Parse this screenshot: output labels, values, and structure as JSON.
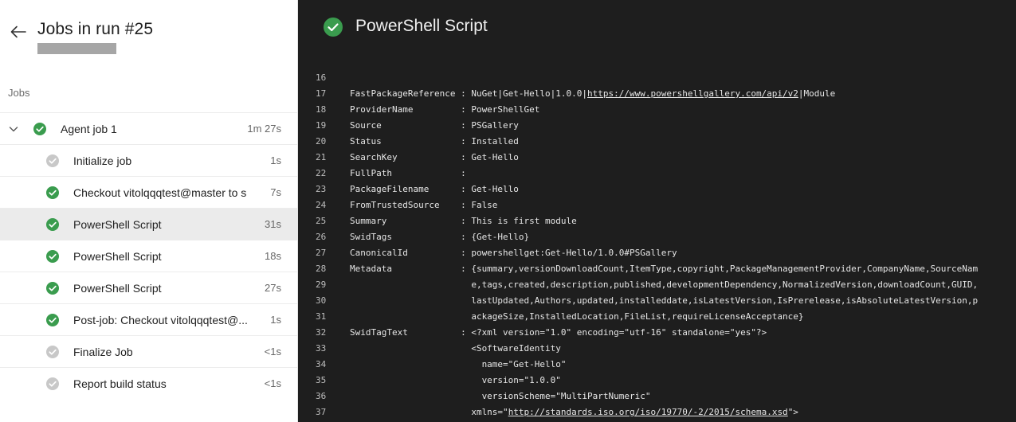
{
  "header": {
    "title": "Jobs in run #25"
  },
  "jobs_section": {
    "label": "Jobs"
  },
  "jobs": [
    {
      "label": "Agent job 1",
      "time": "1m 27s",
      "status": "success",
      "level": 0,
      "expanded": true
    },
    {
      "label": "Initialize job",
      "time": "1s",
      "status": "skipped",
      "level": 1
    },
    {
      "label": "Checkout vitolqqqtest@master to s",
      "time": "7s",
      "status": "success",
      "level": 1
    },
    {
      "label": "PowerShell Script",
      "time": "31s",
      "status": "success",
      "level": 1,
      "selected": true
    },
    {
      "label": "PowerShell Script",
      "time": "18s",
      "status": "success",
      "level": 1
    },
    {
      "label": "PowerShell Script",
      "time": "27s",
      "status": "success",
      "level": 1
    },
    {
      "label": "Post-job: Checkout vitolqqqtest@...",
      "time": "1s",
      "status": "success",
      "level": 1
    },
    {
      "label": "Finalize Job",
      "time": "<1s",
      "status": "skipped",
      "level": 1
    },
    {
      "label": "Report build status",
      "time": "<1s",
      "status": "skipped",
      "level": 1
    }
  ],
  "step": {
    "title": "PowerShell Script",
    "status": "success"
  },
  "log": [
    {
      "n": "16",
      "text": ""
    },
    {
      "n": "17",
      "text": "FastPackageReference : NuGet|Get-Hello|1.0.0|",
      "link": "https://www.powershellgallery.com/api/v2",
      "after": "|Module"
    },
    {
      "n": "18",
      "text": "ProviderName         : PowerShellGet"
    },
    {
      "n": "19",
      "text": "Source               : PSGallery"
    },
    {
      "n": "20",
      "text": "Status               : Installed"
    },
    {
      "n": "21",
      "text": "SearchKey            : Get-Hello"
    },
    {
      "n": "22",
      "text": "FullPath             :"
    },
    {
      "n": "23",
      "text": "PackageFilename      : Get-Hello"
    },
    {
      "n": "24",
      "text": "FromTrustedSource    : False"
    },
    {
      "n": "25",
      "text": "Summary              : This is first module"
    },
    {
      "n": "26",
      "text": "SwidTags             : {Get-Hello}"
    },
    {
      "n": "27",
      "text": "CanonicalId          : powershellget:Get-Hello/1.0.0#PSGallery"
    },
    {
      "n": "28",
      "text": "Metadata             : {summary,versionDownloadCount,ItemType,copyright,PackageManagementProvider,CompanyName,SourceNam"
    },
    {
      "n": "29",
      "text": "                       e,tags,created,description,published,developmentDependency,NormalizedVersion,downloadCount,GUID,"
    },
    {
      "n": "30",
      "text": "                       lastUpdated,Authors,updated,installeddate,isLatestVersion,IsPrerelease,isAbsoluteLatestVersion,p"
    },
    {
      "n": "31",
      "text": "                       ackageSize,InstalledLocation,FileList,requireLicenseAcceptance}"
    },
    {
      "n": "32",
      "text": "SwidTagText          : <?xml version=\"1.0\" encoding=\"utf-16\" standalone=\"yes\"?>"
    },
    {
      "n": "33",
      "text": "                       <SoftwareIdentity"
    },
    {
      "n": "34",
      "text": "                         name=\"Get-Hello\""
    },
    {
      "n": "35",
      "text": "                         version=\"1.0.0\""
    },
    {
      "n": "36",
      "text": "                         versionScheme=\"MultiPartNumeric\""
    },
    {
      "n": "37",
      "text": "                       xmlns=\"",
      "link": "http://standards.iso.org/iso/19770/-2/2015/schema.xsd",
      "after": "\">"
    }
  ],
  "colors": {
    "success": "#3a9c4e",
    "skipped": "#c8c8c8",
    "log_background": "#1e1e1e"
  }
}
